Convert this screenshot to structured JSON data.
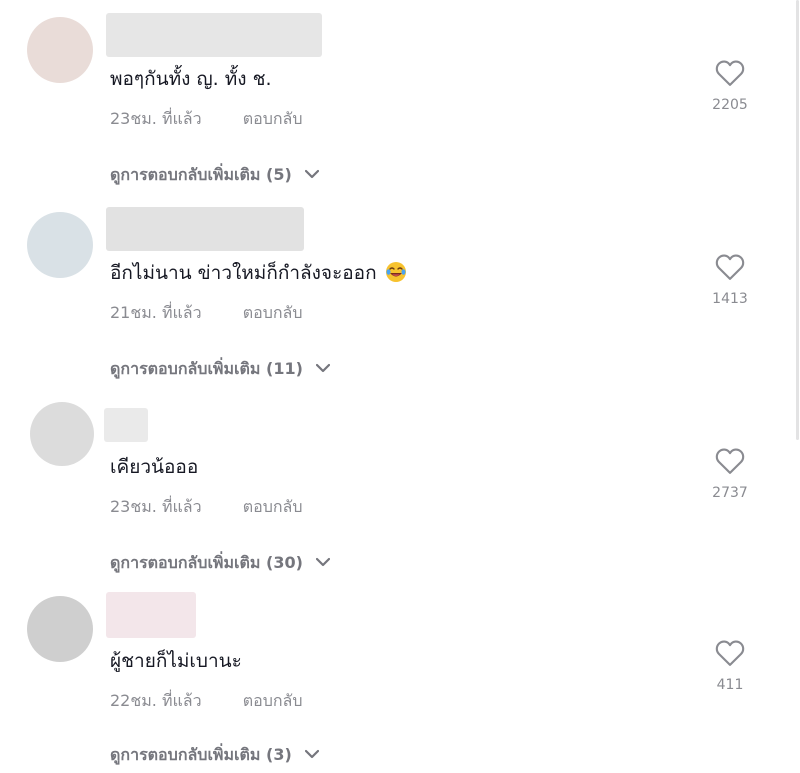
{
  "comments": [
    {
      "text": "พอๆกันทั้ง ญ. ทั้ง ช.",
      "time": "23ชม. ที่แล้ว",
      "reply_label": "ตอบกลับ",
      "view_replies": "ดูการตอบกลับเพิ่มเติม (5)",
      "likes": "2205",
      "avatar_color": "#e9dcd8",
      "username_color": "#e6e6e6"
    },
    {
      "text": "อีกไม่นาน ข่าวใหม่ก็กำลังจะออก",
      "emoji": "rolling-laughing-emoji",
      "time": "21ชม. ที่แล้ว",
      "reply_label": "ตอบกลับ",
      "view_replies": "ดูการตอบกลับเพิ่มเติม (11)",
      "likes": "1413",
      "avatar_color": "#d9e1e6",
      "username_color": "#e2e2e2"
    },
    {
      "text": "เคียวน้อออ",
      "time": "23ชม. ที่แล้ว",
      "reply_label": "ตอบกลับ",
      "view_replies": "ดูการตอบกลับเพิ่มเติม (30)",
      "likes": "2737",
      "avatar_color": "#dcdcdc",
      "username_color": "#eaeaea"
    },
    {
      "text": "ผู้ชายก็ไม่เบานะ",
      "time": "22ชม. ที่แล้ว",
      "reply_label": "ตอบกลับ",
      "view_replies": "ดูการตอบกลับเพิ่มเติม (3)",
      "likes": "411",
      "avatar_color": "#cfcfcf",
      "username_color": "#f3e6ea"
    }
  ],
  "colors": {
    "text_primary": "#161823",
    "text_secondary": "#8a8b91",
    "heart_outline": "#8a8b91"
  }
}
